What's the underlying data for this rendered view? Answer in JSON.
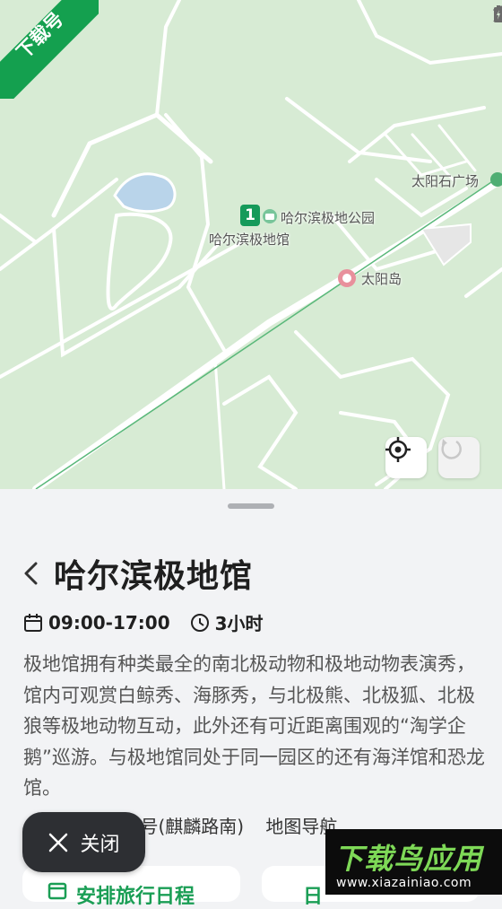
{
  "map": {
    "labels": {
      "park": "哈尔滨极地公园",
      "venue": "哈尔滨极地馆",
      "square": "太阳石广场",
      "island": "太阳岛",
      "route_badge": "1"
    }
  },
  "corner_logo": {
    "text": "下载号"
  },
  "detail": {
    "title": "哈尔滨极地馆",
    "hours": "09:00-17:00",
    "duration": "3小时",
    "description": "极地馆拥有种类最全的南北极动物和极地动物表演秀，馆内可观赏白鲸秀、海豚秀，与北极熊、北极狐、北极狼等极地动物互动，此外还有可近距离围观的“淘学企鹅”巡游。与极地馆同处于同一园区的还有海洋馆和恐龙馆。",
    "address_visible": "77号(麒麟路南)",
    "map_nav": "地图导航"
  },
  "buttons": {
    "close": "关闭",
    "arrange": "安排旅行日程",
    "second_partial": "日"
  },
  "watermark": {
    "title": "下载鸟应用",
    "url": "www.xiazainiao.com"
  },
  "colors": {
    "accent": "#1a9e55",
    "map_bg": "#d7ebd4",
    "road": "#ffffff"
  }
}
